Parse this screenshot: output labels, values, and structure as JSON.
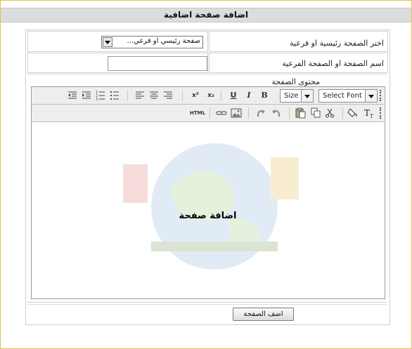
{
  "page": {
    "title": "اضافة صفحة اضافية"
  },
  "form": {
    "parent_label": "اختر الصفحة رئيسية او فرعية",
    "parent_select_value": "صفحة رئيسي او فرعي...",
    "name_label": "اسم الصفحة او الصفحة الفرعية",
    "name_value": "",
    "content_label": "محتوى الصفحة",
    "submit_label": "اضف الصفحة"
  },
  "toolbar": {
    "font_select": "Select Font",
    "size_select": "Size",
    "bold": "B",
    "italic": "I",
    "underline": "U",
    "superscript": "x²",
    "subscript": "x₂",
    "html": "HTML"
  },
  "editor": {
    "content": "اضافة صفحة"
  },
  "icons": [
    "ordered-list-icon",
    "unordered-list-icon",
    "outdent-icon",
    "indent-icon",
    "align-left-icon",
    "align-center-icon",
    "align-right-icon",
    "cut-icon",
    "copy-icon",
    "paste-icon",
    "undo-icon",
    "redo-icon",
    "image-icon",
    "link-icon",
    "text-color-icon",
    "background-color-icon"
  ],
  "colors": {
    "frame_border": "#e0c14a",
    "title_bg": "#dcdcdc",
    "toolbar_bg": "#eeeeee"
  }
}
